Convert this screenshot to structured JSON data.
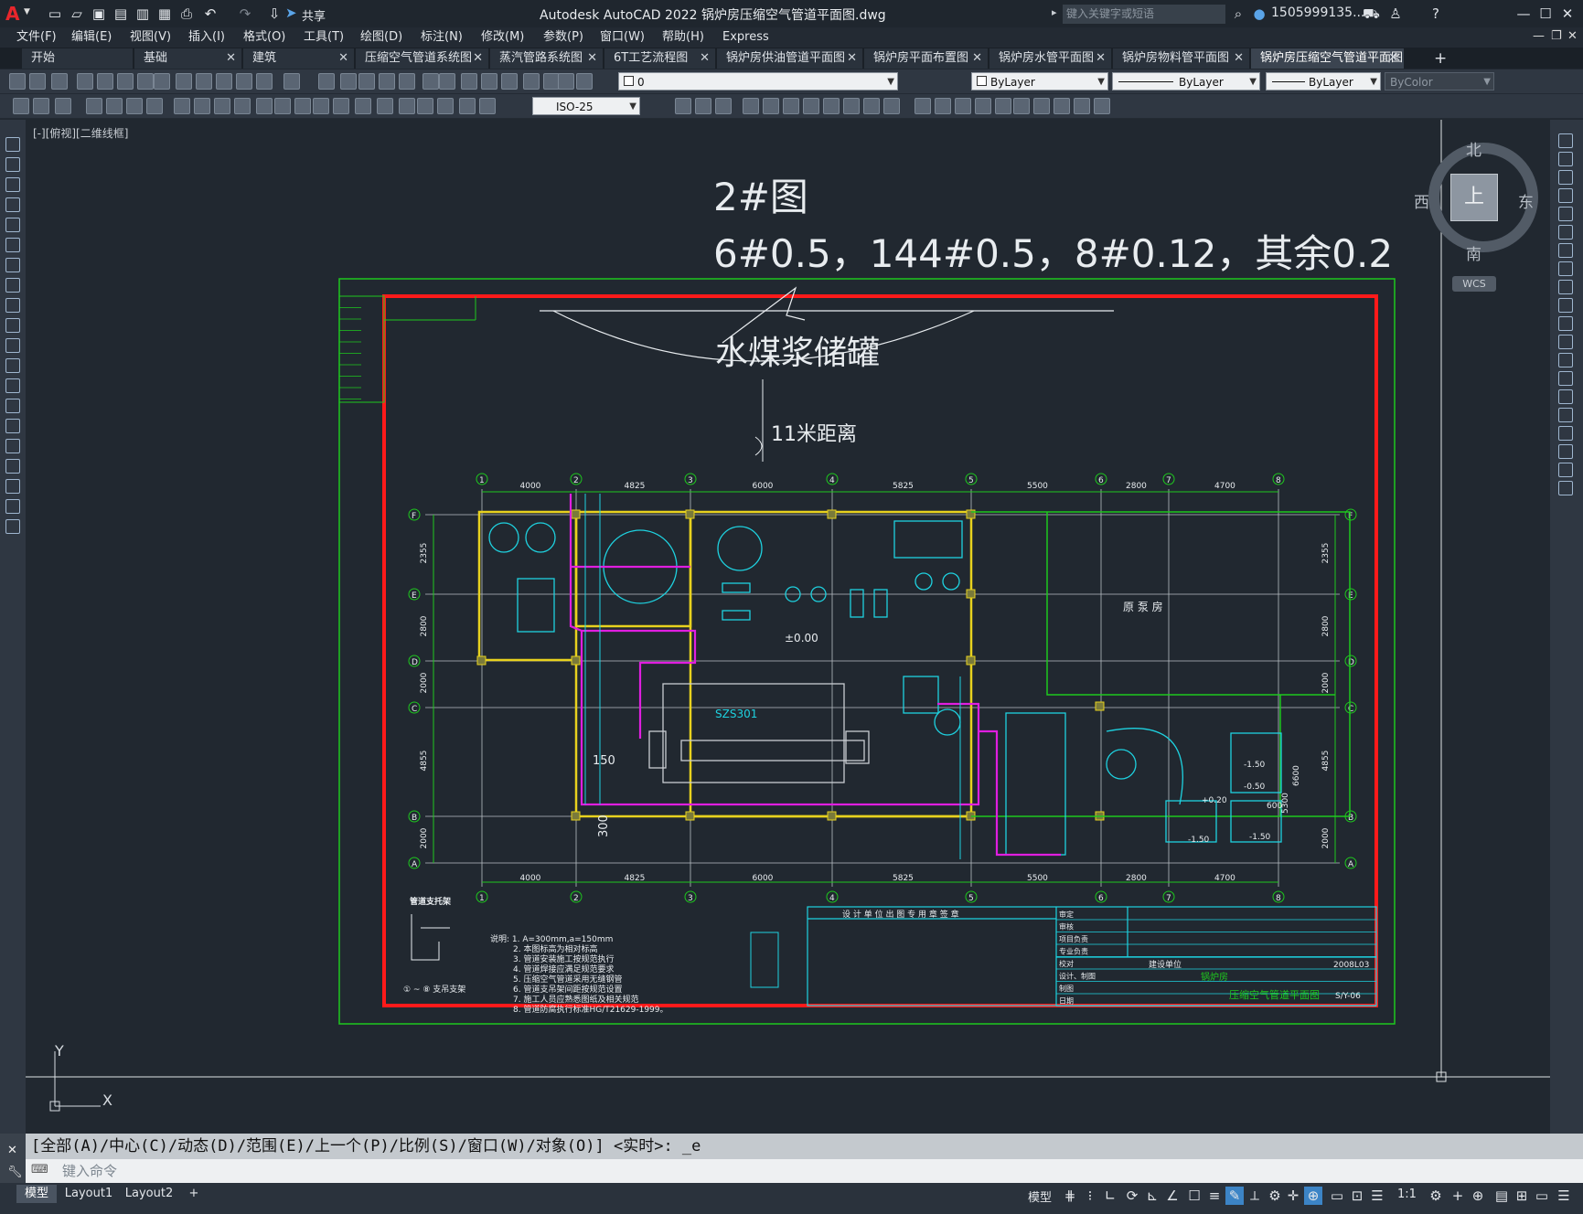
{
  "titlebar": {
    "app_title": "Autodesk AutoCAD 2022    锅炉房压缩空气管道平面图.dwg",
    "search_placeholder": "键入关键字或短语",
    "user_name": "1505999135...",
    "share_label": "共享"
  },
  "menu": [
    "文件(F)",
    "编辑(E)",
    "视图(V)",
    "插入(I)",
    "格式(O)",
    "工具(T)",
    "绘图(D)",
    "标注(N)",
    "修改(M)",
    "参数(P)",
    "窗口(W)",
    "帮助(H)",
    "Express"
  ],
  "tabs": [
    {
      "label": "开始"
    },
    {
      "label": "基础"
    },
    {
      "label": "建筑"
    },
    {
      "label": "压缩空气管道系统图"
    },
    {
      "label": "蒸汽管路系统图"
    },
    {
      "label": "6T工艺流程图"
    },
    {
      "label": "锅炉房供油管道平面图"
    },
    {
      "label": "锅炉房平面布置图"
    },
    {
      "label": "锅炉房水管平面图"
    },
    {
      "label": "锅炉房物料管平面图"
    },
    {
      "label": "锅炉房压缩空气管道平面图*"
    }
  ],
  "toolbar": {
    "layer_value": "0",
    "dimstyle_value": "ISO-25",
    "color_value": "ByLayer",
    "linetype_value": "ByLayer",
    "lineweight_value": "ByLayer",
    "plotstyle_value": "ByColor"
  },
  "viewport": {
    "label": "[-][俯视][二维线框]",
    "viewcube_face": "上",
    "north": "北",
    "south": "南",
    "east": "东",
    "west": "西",
    "wcs": "WCS"
  },
  "drawing": {
    "note_title": "2#图",
    "note_specs": "6#0.5，144#0.5，8#0.12，其余0.2",
    "tank_label": "水煤浆储罐",
    "distance_label": "11米距离",
    "room_label": "原 泵 房",
    "boiler_label": "SZS301",
    "elevation_label": "±0.00",
    "dim_150": "150",
    "dim_300": "300",
    "grid_top_dims": [
      "4000",
      "4825",
      "6000",
      "5825",
      "5500",
      "2800",
      "4700"
    ],
    "grid_rows": [
      "F",
      "E",
      "D",
      "C",
      "B",
      "A"
    ],
    "grid_cols": [
      "1",
      "2",
      "3",
      "4",
      "5",
      "6",
      "7",
      "8"
    ],
    "row_dims": [
      "2355",
      "2800",
      "2000",
      "4855",
      "2000"
    ],
    "levels": [
      "-1.50",
      "-0.50",
      "+0.20",
      "-1.50",
      "-1.50"
    ],
    "right_dims": [
      "6600",
      "5300",
      "600"
    ],
    "notes": [
      "说明: 1. A=300mm,a=150mm",
      "2. 本图标高为相对标高",
      "3. 管道安装施工按规范执行",
      "4. 管道焊接应满足规范要求",
      "5. 压缩空气管道采用无缝钢管",
      "6. 管道支吊架间距按规范设置",
      "7. 施工人员应熟悉图纸及相关规范",
      "8. 管道防腐执行标准HG/T21629-1999。"
    ],
    "detail_label": "管道支托架",
    "detail_sub": "① ~ ⑧ 支吊支架",
    "titleblock_header": "设 计 单 位 出 图 专 用 章 签 章",
    "titleblock_drawing_name": "压缩空气管道平面图",
    "titleblock_project": "锅炉房",
    "titleblock_no": "2008L03",
    "titleblock_sheet": "S/Y-06",
    "titleblock_rows": [
      "审定",
      "审核",
      "项目负责",
      "专业负责",
      "校对",
      "设计、制图",
      "制图",
      "日期"
    ],
    "titleblock_dept": "建设单位"
  },
  "command": {
    "history": "[全部(A)/中心(C)/动态(D)/范围(E)/上一个(P)/比例(S)/窗口(W)/对象(O)] <实时>: _e",
    "placeholder": "键入命令"
  },
  "status": {
    "layout_tabs": [
      "模型",
      "Layout1",
      "Layout2"
    ],
    "model_label": "模型",
    "scale": "1:1"
  },
  "colors": {
    "frame_red": "#ff1a1a",
    "frame_green": "#1ec81e",
    "pipe_magenta": "#e01ee0",
    "wall_yellow": "#e8d21e",
    "equip_cyan": "#1ed2e0",
    "grid_white": "#d8dde2"
  }
}
